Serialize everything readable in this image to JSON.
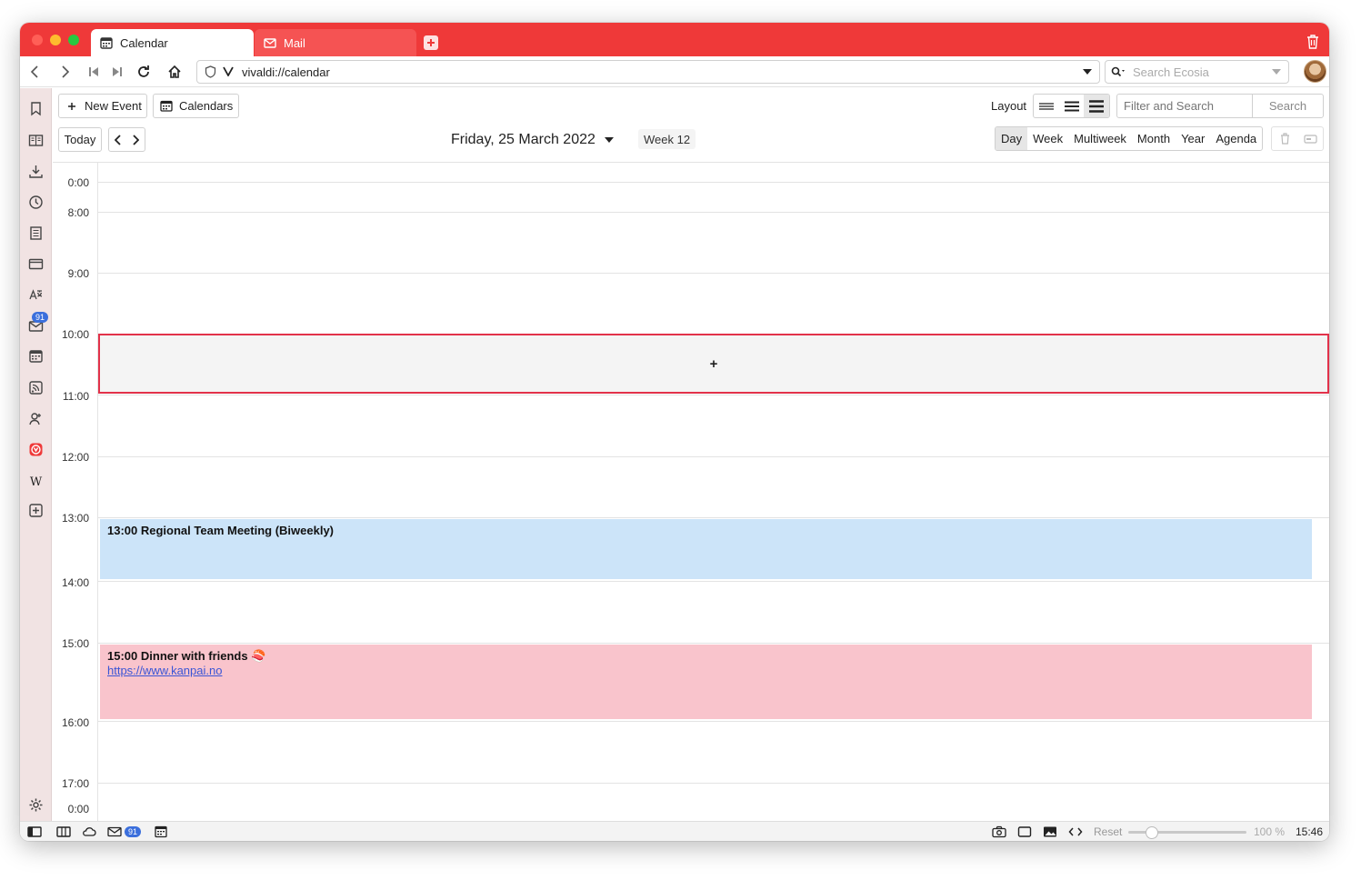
{
  "window": {
    "tabs": [
      {
        "label": "Calendar",
        "icon": "calendar-icon",
        "active": true
      },
      {
        "label": "Mail",
        "icon": "mail-icon",
        "active": false
      }
    ]
  },
  "address": {
    "url": "vivaldi://calendar",
    "search_placeholder": "Search Ecosia"
  },
  "sidebar": {
    "mail_badge": "91"
  },
  "toolbar": {
    "new_event": "New Event",
    "calendars": "Calendars",
    "layout_label": "Layout",
    "filter_placeholder": "Filter and Search",
    "search_button": "Search",
    "today": "Today"
  },
  "header": {
    "date": "Friday, 25 March 2022",
    "week": "Week 12"
  },
  "views": [
    {
      "label": "Day",
      "selected": true
    },
    {
      "label": "Week",
      "selected": false
    },
    {
      "label": "Multiweek",
      "selected": false
    },
    {
      "label": "Month",
      "selected": false
    },
    {
      "label": "Year",
      "selected": false
    },
    {
      "label": "Agenda",
      "selected": false
    }
  ],
  "hours": [
    "0:00",
    "8:00",
    "9:00",
    "10:00",
    "11:00",
    "12:00",
    "13:00",
    "14:00",
    "15:00",
    "16:00",
    "17:00",
    "0:00"
  ],
  "selection_glyph": "+",
  "events": [
    {
      "time": "13:00",
      "title": "Regional Team Meeting (Biweekly)",
      "color": "#cce4f9"
    },
    {
      "time": "15:00",
      "title": "Dinner with friends 🍣",
      "link": "https://www.kanpai.no",
      "color": "#f9c4cc"
    }
  ],
  "statusbar": {
    "mail_badge": "91",
    "reset": "Reset",
    "zoom": "100 %",
    "clock": "15:46"
  },
  "colors": {
    "accent": "#ef3939",
    "selection_border": "#e2324a",
    "badge": "#3b6fdc"
  }
}
